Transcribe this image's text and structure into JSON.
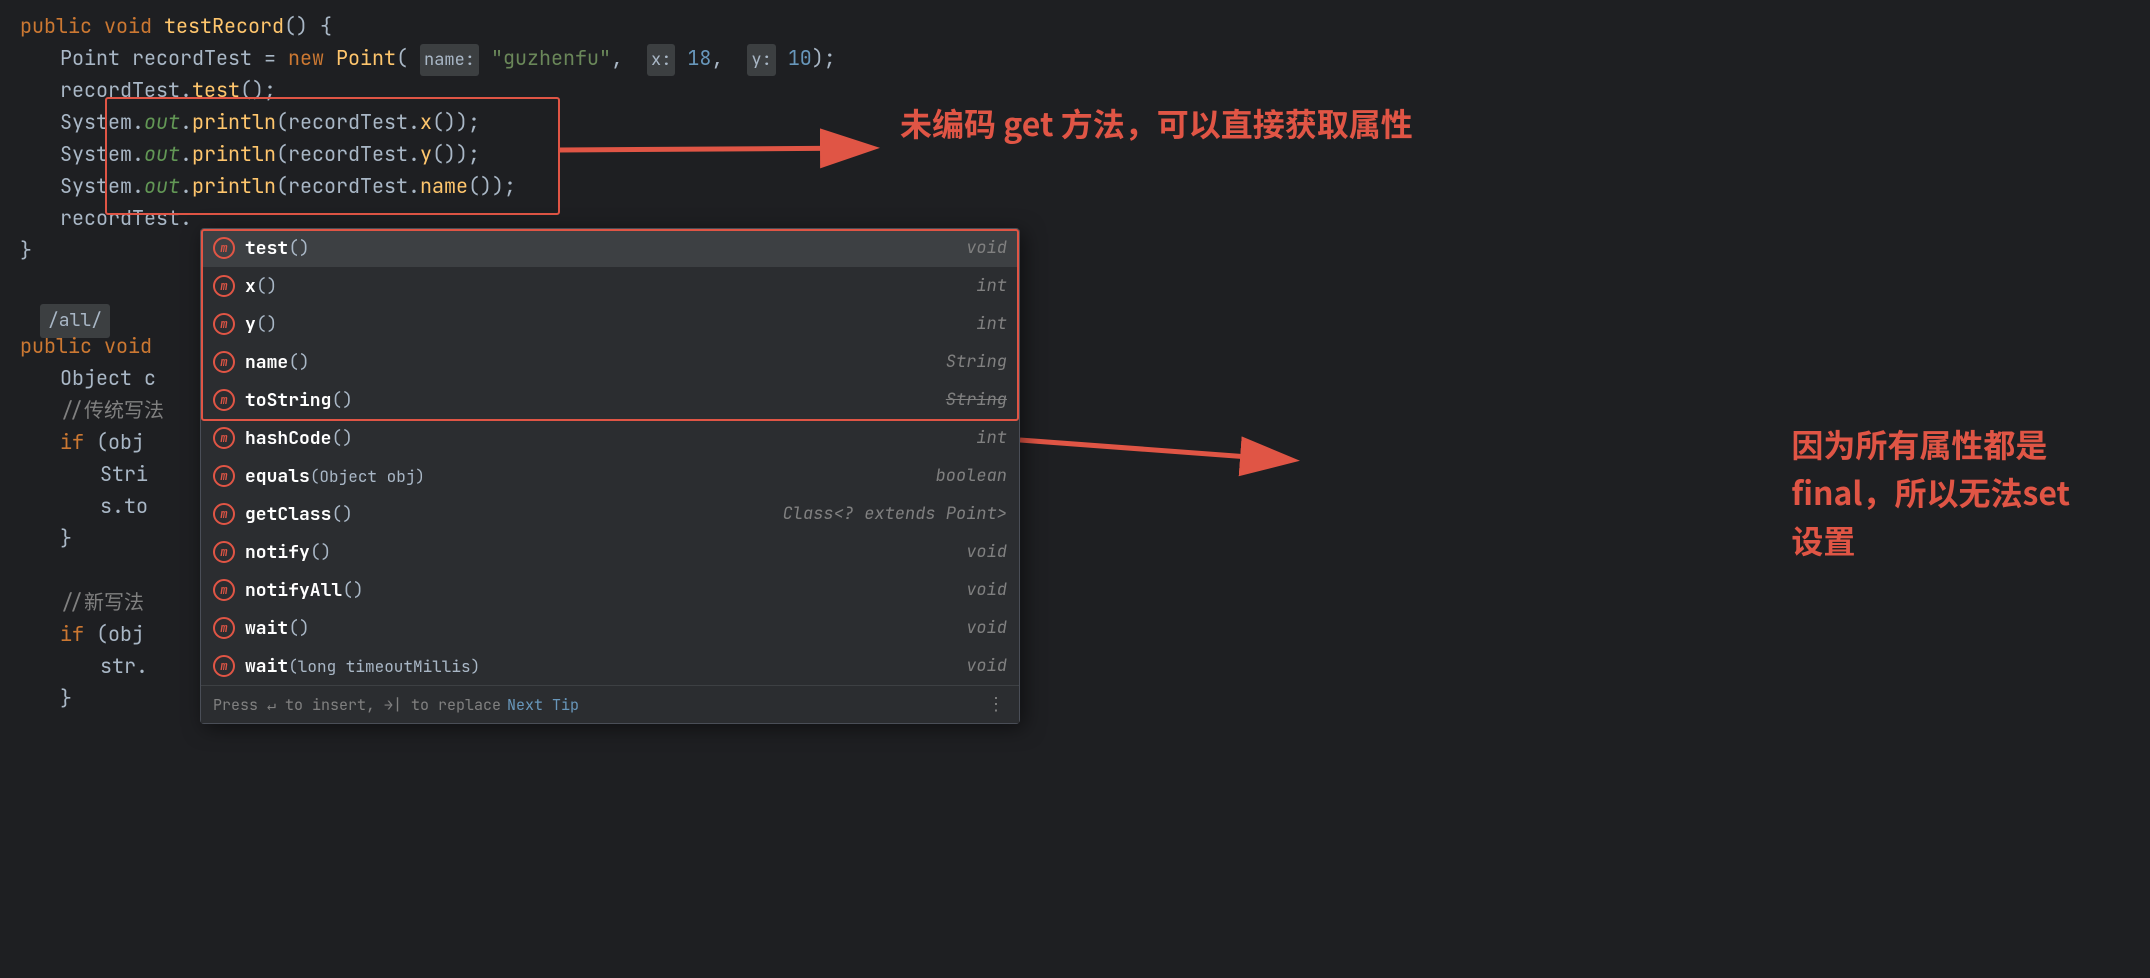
{
  "editor": {
    "background": "#1e1f22",
    "code_lines": [
      {
        "indent": 0,
        "content": "public void testRecord() {"
      },
      {
        "indent": 1,
        "content": "Point recordTest = new Point( name: \"guzhenfu\",  x: 18,  y: 10);"
      },
      {
        "indent": 1,
        "content": "recordTest.test();"
      },
      {
        "indent": 1,
        "content": "System.out.println(recordTest.x());"
      },
      {
        "indent": 1,
        "content": "System.out.println(recordTest.y());"
      },
      {
        "indent": 1,
        "content": "System.out.println(recordTest.name());"
      },
      {
        "indent": 1,
        "content": "recordTest."
      }
    ],
    "bottom_lines": [
      {
        "content": "}"
      },
      {
        "content": ""
      },
      {
        "content": "/all/"
      },
      {
        "content": "public void"
      },
      {
        "content": "    Object c"
      },
      {
        "content": "    //传统写法"
      },
      {
        "content": "    if (obj"
      },
      {
        "content": "        Stri"
      },
      {
        "content": "        s.to"
      },
      {
        "content": "    }"
      },
      {
        "content": ""
      },
      {
        "content": "    //新写法"
      },
      {
        "content": "    if (obj"
      },
      {
        "content": "        str."
      },
      {
        "content": "    }"
      }
    ]
  },
  "autocomplete": {
    "items": [
      {
        "name": "test",
        "params": "()",
        "return_type": "void",
        "highlighted": true
      },
      {
        "name": "x",
        "params": "()",
        "return_type": "int",
        "highlighted": true
      },
      {
        "name": "y",
        "params": "()",
        "return_type": "int",
        "highlighted": true
      },
      {
        "name": "name",
        "params": "()",
        "return_type": "String",
        "highlighted": true
      },
      {
        "name": "toString",
        "params": "()",
        "return_type": "String",
        "highlighted": false
      },
      {
        "name": "hashCode",
        "params": "()",
        "return_type": "int",
        "highlighted": false
      },
      {
        "name": "equals",
        "params": "(Object obj)",
        "return_type": "boolean",
        "highlighted": false
      },
      {
        "name": "getClass",
        "params": "()",
        "return_type": "Class<? extends Point>",
        "highlighted": false
      },
      {
        "name": "notify",
        "params": "()",
        "return_type": "void",
        "highlighted": false
      },
      {
        "name": "notifyAll",
        "params": "()",
        "return_type": "void",
        "highlighted": false
      },
      {
        "name": "wait",
        "params": "()",
        "return_type": "void",
        "highlighted": false
      },
      {
        "name": "wait",
        "params": "(long timeoutMillis)",
        "return_type": "void",
        "highlighted": false
      }
    ],
    "footer": {
      "hint_text": "Press ↵ to insert, →| to replace",
      "next_tip_label": "Next Tip",
      "dots": "⋮"
    }
  },
  "annotations": {
    "text1": "未编码 get 方法，可以直接获取属性",
    "text2_line1": "因为所有属性都是",
    "text2_line2": "final，所以无法set",
    "text2_line3": "设置"
  }
}
